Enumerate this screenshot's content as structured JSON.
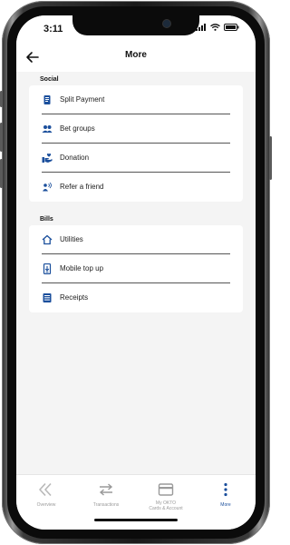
{
  "status_bar": {
    "time": "3:11"
  },
  "header": {
    "title": "More"
  },
  "sections": [
    {
      "title": "Social",
      "items": [
        {
          "label": "Split Payment",
          "icon": "split-payment-icon"
        },
        {
          "label": "Bet groups",
          "icon": "group-icon"
        },
        {
          "label": "Donation",
          "icon": "donation-icon"
        },
        {
          "label": "Refer a friend",
          "icon": "refer-icon"
        }
      ]
    },
    {
      "title": "Bills",
      "items": [
        {
          "label": "Utilities",
          "icon": "home-icon"
        },
        {
          "label": "Mobile top up",
          "icon": "mobile-icon"
        },
        {
          "label": "Receipts",
          "icon": "receipt-icon"
        }
      ]
    }
  ],
  "bottom_nav": [
    {
      "label": "Overview",
      "icon": "overview-icon",
      "active": false
    },
    {
      "label": "Transactions",
      "icon": "transactions-icon",
      "active": false
    },
    {
      "label": "My OKTO\nCards & Account",
      "line1": "My OKTO",
      "line2": "Cards & Account",
      "icon": "card-icon",
      "active": false
    },
    {
      "label": "More",
      "icon": "more-vertical-icon",
      "active": true
    }
  ],
  "colors": {
    "accent": "#1b4f9c",
    "inactive": "#9a9a9a",
    "background": "#f4f4f4"
  }
}
